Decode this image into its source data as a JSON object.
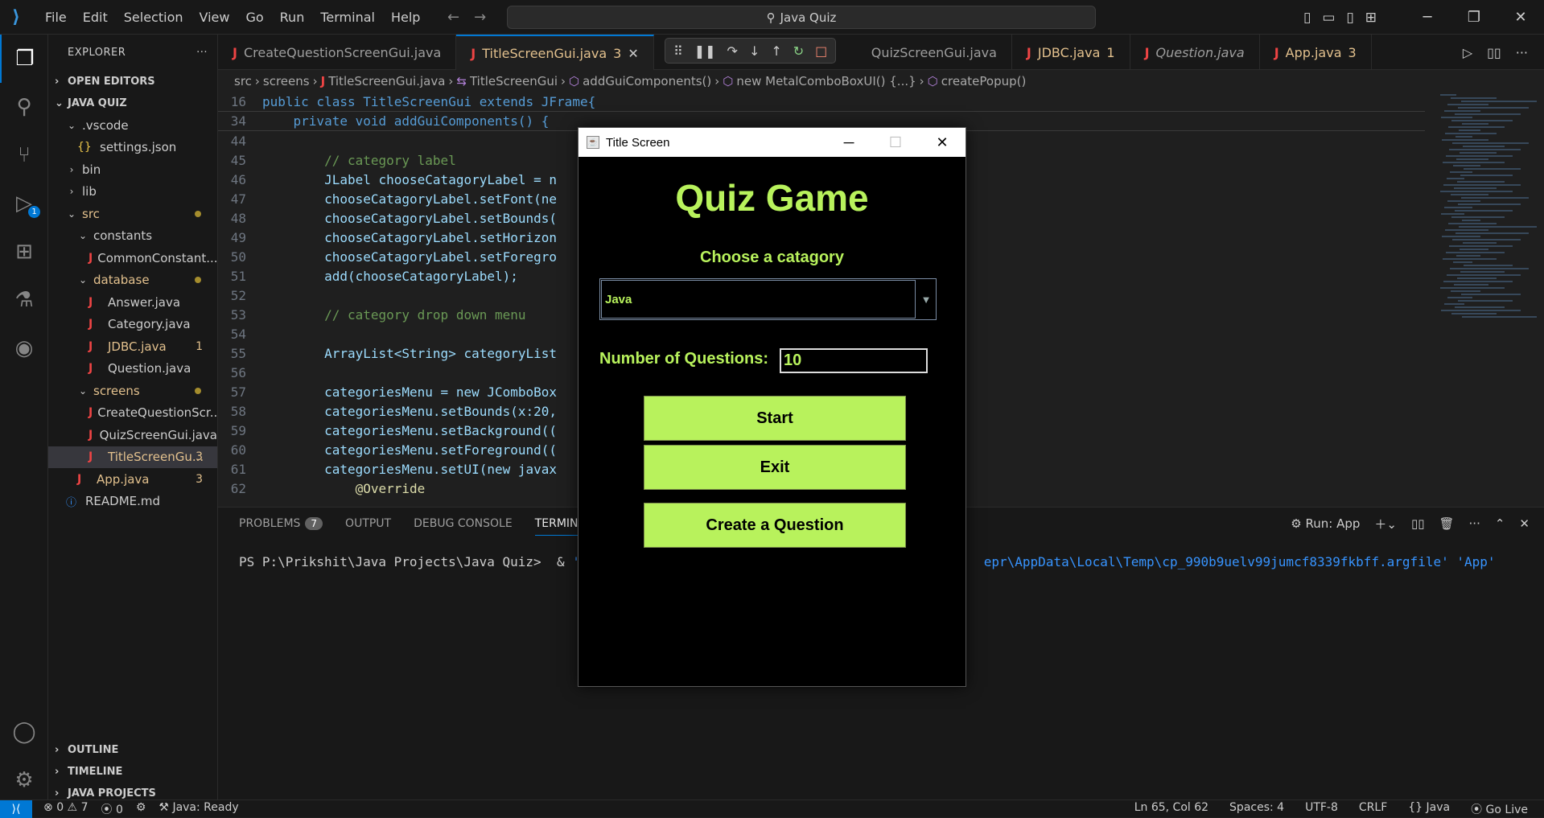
{
  "titlebar": {
    "menu": [
      "File",
      "Edit",
      "Selection",
      "View",
      "Go",
      "Run",
      "Terminal",
      "Help"
    ],
    "search": "Java Quiz"
  },
  "activity": {
    "debug_badge": "1"
  },
  "explorer": {
    "title": "EXPLORER",
    "open_editors": "OPEN EDITORS",
    "workspace": "JAVA QUIZ",
    "rows": [
      {
        "label": ".vscode",
        "type": "folder-open",
        "indent": 1
      },
      {
        "label": "settings.json",
        "type": "json",
        "indent": 2
      },
      {
        "label": "bin",
        "type": "folder-closed",
        "indent": 1
      },
      {
        "label": "lib",
        "type": "folder-closed",
        "indent": 1
      },
      {
        "label": "src",
        "type": "folder-open",
        "indent": 1,
        "modified": true
      },
      {
        "label": "constants",
        "type": "folder-open",
        "indent": 2
      },
      {
        "label": "CommonConstant...",
        "type": "java",
        "indent": 3
      },
      {
        "label": "database",
        "type": "folder-open",
        "indent": 2,
        "modified": true
      },
      {
        "label": "Answer.java",
        "type": "java",
        "indent": 3
      },
      {
        "label": "Category.java",
        "type": "java",
        "indent": 3
      },
      {
        "label": "JDBC.java",
        "type": "java",
        "indent": 3,
        "modified": true,
        "count": "1"
      },
      {
        "label": "Question.java",
        "type": "java",
        "indent": 3
      },
      {
        "label": "screens",
        "type": "folder-open",
        "indent": 2,
        "modified": true
      },
      {
        "label": "CreateQuestionScr...",
        "type": "java",
        "indent": 3
      },
      {
        "label": "QuizScreenGui.java",
        "type": "java",
        "indent": 3
      },
      {
        "label": "TitleScreenGu...",
        "type": "java",
        "indent": 3,
        "modified": true,
        "count": "3",
        "selected": true
      },
      {
        "label": "App.java",
        "type": "java",
        "indent": 2,
        "modified": true,
        "count": "3"
      },
      {
        "label": "README.md",
        "type": "info",
        "indent": 1
      }
    ],
    "bottom_sections": [
      "OUTLINE",
      "TIMELINE",
      "JAVA PROJECTS"
    ]
  },
  "tabs": [
    {
      "label": "CreateQuestionScreenGui.java"
    },
    {
      "label": "TitleScreenGui.java",
      "count": "3",
      "active": true
    },
    {
      "label": "QuizScreenGui.java"
    },
    {
      "label": "JDBC.java",
      "count": "1",
      "warn": true
    },
    {
      "label": "Question.java",
      "italic": true
    },
    {
      "label": "App.java",
      "count": "3",
      "warn": true
    }
  ],
  "breadcrumb": [
    "src",
    "screens",
    "TitleScreenGui.java",
    "TitleScreenGui",
    "addGuiComponents()",
    "new MetalComboBoxUI() {...}",
    "createPopup()"
  ],
  "code": {
    "sticky": [
      {
        "n": "16",
        "t": "public class TitleScreenGui extends JFrame{"
      },
      {
        "n": "34",
        "t": "    private void addGuiComponents() {"
      }
    ],
    "lines": [
      {
        "n": "44",
        "t": ""
      },
      {
        "n": "45",
        "t": "        // category label"
      },
      {
        "n": "46",
        "t": "        JLabel chooseCatagoryLabel = n"
      },
      {
        "n": "47",
        "t": "        chooseCatagoryLabel.setFont(ne"
      },
      {
        "n": "48",
        "t": "        chooseCatagoryLabel.setBounds("
      },
      {
        "n": "49",
        "t": "        chooseCatagoryLabel.setHorizon"
      },
      {
        "n": "50",
        "t": "        chooseCatagoryLabel.setForegro"
      },
      {
        "n": "51",
        "t": "        add(chooseCatagoryLabel);"
      },
      {
        "n": "52",
        "t": ""
      },
      {
        "n": "53",
        "t": "        // category drop down menu"
      },
      {
        "n": "54",
        "t": ""
      },
      {
        "n": "55",
        "t": "        ArrayList<String> categoryList"
      },
      {
        "n": "56",
        "t": ""
      },
      {
        "n": "57",
        "t": "        categoriesMenu = new JComboBox"
      },
      {
        "n": "58",
        "t": "        categoriesMenu.setBounds(x:20,"
      },
      {
        "n": "59",
        "t": "        categoriesMenu.setBackground(("
      },
      {
        "n": "60",
        "t": "        categoriesMenu.setForeground(("
      },
      {
        "n": "61",
        "t": "        categoriesMenu.setUI(new javax"
      },
      {
        "n": "62",
        "t": "            @Override"
      }
    ]
  },
  "panel": {
    "tabs": [
      "PROBLEMS",
      "OUTPUT",
      "DEBUG CONSOLE",
      "TERMINAL"
    ],
    "problems_count": "7",
    "run_label": "Run: App",
    "terminal_prompt": "PS P:\\Prikshit\\Java Projects\\Java Quiz>  & ",
    "terminal_str1": "'C:\\",
    "terminal_str2": "epr\\AppData\\Local\\Temp\\cp_990b9uelv99jumcf8339fkbff.argfile' 'App'"
  },
  "statusbar": {
    "errors": "0",
    "warnings": "7",
    "ports": "0",
    "java_status": "Java: Ready",
    "position": "Ln 65, Col 62",
    "spaces": "Spaces: 4",
    "encoding": "UTF-8",
    "eol": "CRLF",
    "language": "Java",
    "golive": "Go Live"
  },
  "java_window": {
    "title": "Title Screen",
    "heading": "Quiz Game",
    "category_label": "Choose a catagory",
    "category_value": "Java",
    "num_questions_label": "Number of Questions:",
    "num_questions_value": "10",
    "start": "Start",
    "exit": "Exit",
    "create": "Create a Question",
    "accent_color": "#b8f25c"
  }
}
